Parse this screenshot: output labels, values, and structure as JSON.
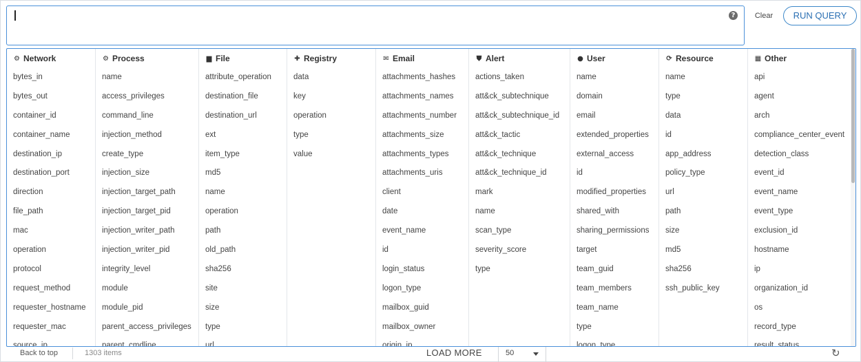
{
  "query": {
    "value": "",
    "help_icon": "question-circle-icon"
  },
  "actions": {
    "clear_label": "Clear",
    "run_label": "RUN QUERY"
  },
  "columns": [
    {
      "title": "Network",
      "icon": "network-icon",
      "glyph": "⚙",
      "items": [
        "bytes_in",
        "bytes_out",
        "container_id",
        "container_name",
        "destination_ip",
        "destination_port",
        "direction",
        "file_path",
        "mac",
        "operation",
        "protocol",
        "request_method",
        "requester_hostname",
        "requester_mac",
        "source_ip"
      ]
    },
    {
      "title": "Process",
      "icon": "process-icon",
      "glyph": "⚙",
      "items": [
        "name",
        "access_privileges",
        "command_line",
        "injection_method",
        "create_type",
        "injection_size",
        "injection_target_path",
        "injection_target_pid",
        "injection_writer_path",
        "injection_writer_pid",
        "integrity_level",
        "module",
        "module_pid",
        "parent_access_privileges",
        "parent_cmdline"
      ]
    },
    {
      "title": "File",
      "icon": "file-icon",
      "glyph": "▆",
      "items": [
        "attribute_operation",
        "destination_file",
        "destination_url",
        "ext",
        "item_type",
        "md5",
        "name",
        "operation",
        "path",
        "old_path",
        "sha256",
        "site",
        "size",
        "type",
        "url"
      ]
    },
    {
      "title": "Registry",
      "icon": "registry-icon",
      "glyph": "✚",
      "items": [
        "data",
        "key",
        "operation",
        "type",
        "value"
      ]
    },
    {
      "title": "Email",
      "icon": "envelope-icon",
      "glyph": "✉",
      "items": [
        "attachments_hashes",
        "attachments_names",
        "attachments_number",
        "attachments_size",
        "attachments_types",
        "attachments_uris",
        "client",
        "date",
        "event_name",
        "id",
        "login_status",
        "logon_type",
        "mailbox_guid",
        "mailbox_owner",
        "origin_ip"
      ]
    },
    {
      "title": "Alert",
      "icon": "shield-icon",
      "glyph": "⛊",
      "items": [
        "actions_taken",
        "att&ck_subtechnique",
        "att&ck_subtechnique_id",
        "att&ck_tactic",
        "att&ck_technique",
        "att&ck_technique_id",
        "mark",
        "name",
        "scan_type",
        "severity_score",
        "type"
      ]
    },
    {
      "title": "User",
      "icon": "user-icon",
      "glyph": "●",
      "items": [
        "name",
        "domain",
        "email",
        "extended_properties",
        "external_access",
        "id",
        "modified_properties",
        "shared_with",
        "sharing_permissions",
        "target",
        "team_guid",
        "team_members",
        "team_name",
        "type",
        "logon_type"
      ]
    },
    {
      "title": "Resource",
      "icon": "sync-icon",
      "glyph": "⟳",
      "items": [
        "name",
        "type",
        "data",
        "id",
        "app_address",
        "policy_type",
        "url",
        "path",
        "size",
        "md5",
        "sha256",
        "ssh_public_key"
      ]
    },
    {
      "title": "Other",
      "icon": "grid-icon",
      "glyph": "▦",
      "items": [
        "api",
        "agent",
        "arch",
        "compliance_center_event",
        "detection_class",
        "event_id",
        "event_name",
        "event_type",
        "exclusion_id",
        "hostname",
        "ip",
        "organization_id",
        "os",
        "record_type",
        "result_status"
      ]
    }
  ],
  "footer": {
    "back_to_top": "Back to top",
    "items_count": "1303 items",
    "load_more": "LOAD MORE",
    "page_size": "50",
    "refresh_icon": "refresh-icon"
  }
}
